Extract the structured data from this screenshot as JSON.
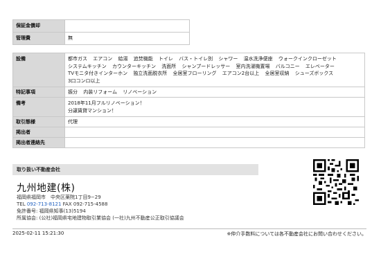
{
  "top_table": [
    {
      "label": "保証金償却",
      "value": ""
    },
    {
      "label": "管理費",
      "value": "無"
    }
  ],
  "details": {
    "equipment_label": "設備",
    "equipment": [
      "都市ガス",
      "エアコン",
      "給湯",
      "追焚機能",
      "トイレ",
      "バス・トイレ別",
      "シャワー",
      "温水洗浄便座",
      "ウォークインクローゼット",
      "システムキッチン",
      "カウンターキッチン",
      "洗面所",
      "シャンプードレッサー",
      "室内洗濯機置場",
      "バルコニー",
      "エレベーター",
      "TVモニタ付きインターホン",
      "独立洗面脱衣所",
      "全居室フローリング",
      "エアコン2台以上",
      "全居室収納",
      "シューズボックス",
      "3口コンロ以上"
    ],
    "features_label": "特記事項",
    "features": [
      "振分",
      "内装リフォーム",
      "リノベーション"
    ],
    "remarks_label": "備考",
    "remarks_line1": "2018年11月フルリノベーション！",
    "remarks_line2": "分譲賃貸マンション！",
    "transaction_label": "取引態様",
    "transaction": "代理",
    "poster_label": "掲出者",
    "poster": "",
    "poster_contact_label": "掲出者連絡先",
    "poster_contact": ""
  },
  "realtor": {
    "section_title": "取り扱い不動産会社",
    "name": "九州地建(株)",
    "address": "福岡県福岡市　中央区薬院1丁目9−29",
    "tel_label": "TEL",
    "tel": "092-713-8121",
    "fax": "FAX 092-715-4588",
    "license": "免許番号: 福岡県知事(13)5194",
    "association": "所属協会: (公社)福岡県宅地建物取引業協会 (一社)九州不動産公正取引協議会"
  },
  "footer": {
    "datetime": "2025-02-11 15:21:30",
    "note": "※仲介手数料については各不動産会社にお問い合わせください。"
  }
}
